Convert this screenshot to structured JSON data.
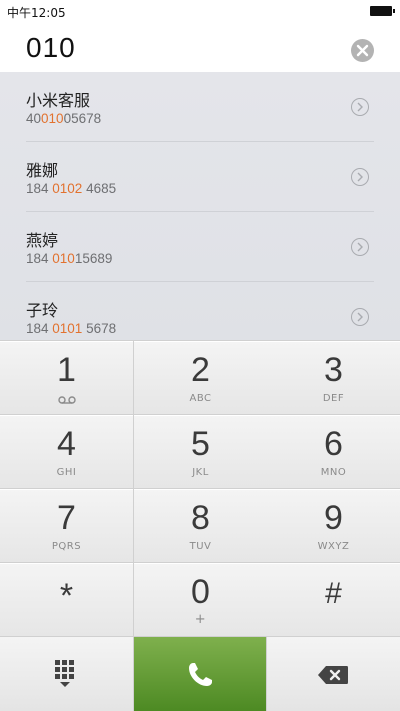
{
  "status": {
    "time": "中午12:05"
  },
  "search": {
    "query": "010"
  },
  "contacts": [
    {
      "name": "小米客服",
      "number_pre": "40",
      "number_hl": "010",
      "number_post": "05678"
    },
    {
      "name": "雅娜",
      "number_pre": "184 ",
      "number_hl": "0102",
      "number_post": " 4685"
    },
    {
      "name": "燕婷",
      "number_pre": "184 ",
      "number_hl": "010",
      "number_post": "15689"
    },
    {
      "name": "子玲",
      "number_pre": "184 ",
      "number_hl": "0101",
      "number_post": " 5678"
    }
  ],
  "keys": [
    {
      "digit": "1",
      "letters": ""
    },
    {
      "digit": "2",
      "letters": "ABC"
    },
    {
      "digit": "3",
      "letters": "DEF"
    },
    {
      "digit": "4",
      "letters": "GHI"
    },
    {
      "digit": "5",
      "letters": "JKL"
    },
    {
      "digit": "6",
      "letters": "MNO"
    },
    {
      "digit": "7",
      "letters": "PQRS"
    },
    {
      "digit": "8",
      "letters": "TUV"
    },
    {
      "digit": "9",
      "letters": "WXYZ"
    },
    {
      "digit": "*",
      "letters": ""
    },
    {
      "digit": "0",
      "letters": "+"
    },
    {
      "digit": "#",
      "letters": ""
    }
  ],
  "icons": {
    "clear": "clear-icon",
    "chevron": "chevron-right-icon",
    "voicemail": "voicemail-icon",
    "dialpad": "dialpad-icon",
    "call": "phone-icon",
    "delete": "backspace-icon"
  },
  "colors": {
    "highlight": "#e2722f",
    "call_button": "#5b9630"
  }
}
